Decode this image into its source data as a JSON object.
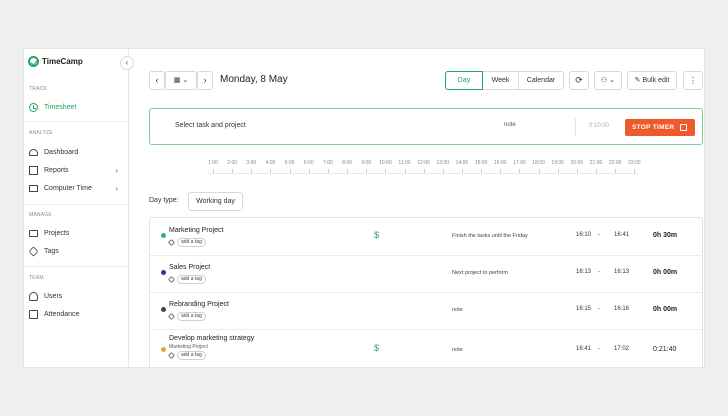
{
  "app": {
    "name": "TimeCamp"
  },
  "sidebar": {
    "sections": [
      {
        "label": "TRACK",
        "items": [
          {
            "label": "Timesheet",
            "icon": "clock-icon",
            "active": true
          }
        ]
      },
      {
        "label": "ANALYZE",
        "items": [
          {
            "label": "Dashboard",
            "icon": "dashboard-icon"
          },
          {
            "label": "Reports",
            "icon": "reports-icon",
            "chevron": true
          },
          {
            "label": "Computer Time",
            "icon": "computer-icon",
            "chevron": true
          }
        ]
      },
      {
        "label": "MANAGE",
        "items": [
          {
            "label": "Projects",
            "icon": "folder-icon"
          },
          {
            "label": "Tags",
            "icon": "tag-icon"
          }
        ]
      },
      {
        "label": "TEAM",
        "items": [
          {
            "label": "Users",
            "icon": "users-icon"
          },
          {
            "label": "Attendance",
            "icon": "attendance-icon"
          }
        ]
      }
    ]
  },
  "toolbar": {
    "date": "Monday, 8 May",
    "views": [
      "Day",
      "Week",
      "Calendar"
    ],
    "active_view": "Day",
    "bulk_edit": "Bulk edit"
  },
  "timer": {
    "task_placeholder": "Select task and project",
    "note": "note",
    "time": "0:10:00",
    "stop_label": "STOP TIMER"
  },
  "hours": [
    "1:00",
    "2:00",
    "3:00",
    "4:00",
    "5:00",
    "6:00",
    "7:00",
    "8:00",
    "9:00",
    "10:00",
    "11:00",
    "12:00",
    "13:00",
    "14:00",
    "15:00",
    "16:00",
    "17:00",
    "18:00",
    "19:00",
    "20:00",
    "21:00",
    "22:00",
    "23:00"
  ],
  "day_type": {
    "label": "Day type:",
    "value": "Working day"
  },
  "entries": [
    {
      "project": "Marketing Project",
      "subproject": "",
      "color": "#2fb37a",
      "tag": "add a tag",
      "billable": true,
      "note": "Finish the tasks until the Friday",
      "start": "16:10",
      "end": "16:41",
      "duration": "0h 30m"
    },
    {
      "project": "Sales Project",
      "subproject": "",
      "color": "#2a3c8f",
      "tag": "add a tag",
      "billable": false,
      "note": "Next project to perform",
      "start": "16:13",
      "end": "16:13",
      "duration": "0h 00m"
    },
    {
      "project": "Rebranding Project",
      "subproject": "",
      "color": "#444444",
      "tag": "add a tag",
      "billable": false,
      "note": "note",
      "start": "16:15",
      "end": "16:16",
      "duration": "0h 00m"
    },
    {
      "project": "Develop marketing strategy",
      "subproject": "Marketing Project",
      "color": "#e8a13a",
      "tag": "add a tag",
      "billable": true,
      "note": "note",
      "start": "16:41",
      "end": "17:02",
      "duration": "0:21:40"
    }
  ]
}
